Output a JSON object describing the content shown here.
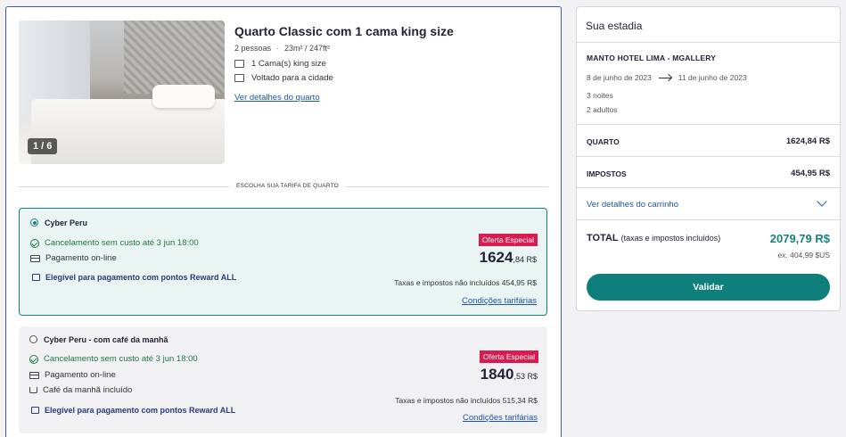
{
  "room": {
    "photo_counter": "1 / 6",
    "title": "Quarto Classic com 1 cama king size",
    "guests": "2 pessoas",
    "size": "23m² / 247ft²",
    "features": [
      "1 Cama(s) king size",
      "Voltado para a cidade"
    ],
    "details_link": "Ver detalhes do quarto"
  },
  "rate_section_label": "ESCOLHA SUA TARIFA DE QUARTO",
  "rates": [
    {
      "name": "Cyber Peru",
      "selected": true,
      "cancellation": "Cancelamento sem custo até 3 jun 18:00",
      "payment": "Pagamento on-line",
      "reward": "Elegível para pagamento com pontos Reward ALL",
      "badge": "Oferta Especial",
      "price_main": "1624",
      "price_cents": ",84 R$",
      "tax_note": "Taxas e impostos não incluídos 454,95 R$",
      "conditions_link": "Condições tarifárias"
    },
    {
      "name": "Cyber Peru - com café da manhã",
      "selected": false,
      "cancellation": "Cancelamento sem custo até 3 jun 18:00",
      "payment": "Pagamento on-line",
      "breakfast": "Café da manhã incluído",
      "reward": "Elegível para pagamento com pontos Reward ALL",
      "badge": "Oferta Especial",
      "price_main": "1840",
      "price_cents": ",53 R$",
      "tax_note": "Taxas e impostos não incluídos 515,34 R$",
      "conditions_link": "Condições tarifárias"
    }
  ],
  "summary": {
    "title": "Sua estadia",
    "hotel": "MANTO HOTEL LIMA - MGALLERY",
    "check_in": "8 de junho de 2023",
    "check_out": "11 de junho de 2023",
    "nights": "3 noites",
    "adults": "2 adultos",
    "room_label": "QUARTO",
    "room_value": "1624,84 R$",
    "taxes_label": "IMPOSTOS",
    "taxes_value": "454,95 R$",
    "cart_link": "Ver detalhes do carrinho",
    "total_label": "TOTAL",
    "total_note": "(taxas e impostos incluídos)",
    "total_value": "2079,79 R$",
    "total_ex": "ex. 404,99 $US",
    "validate_button": "Validar"
  }
}
